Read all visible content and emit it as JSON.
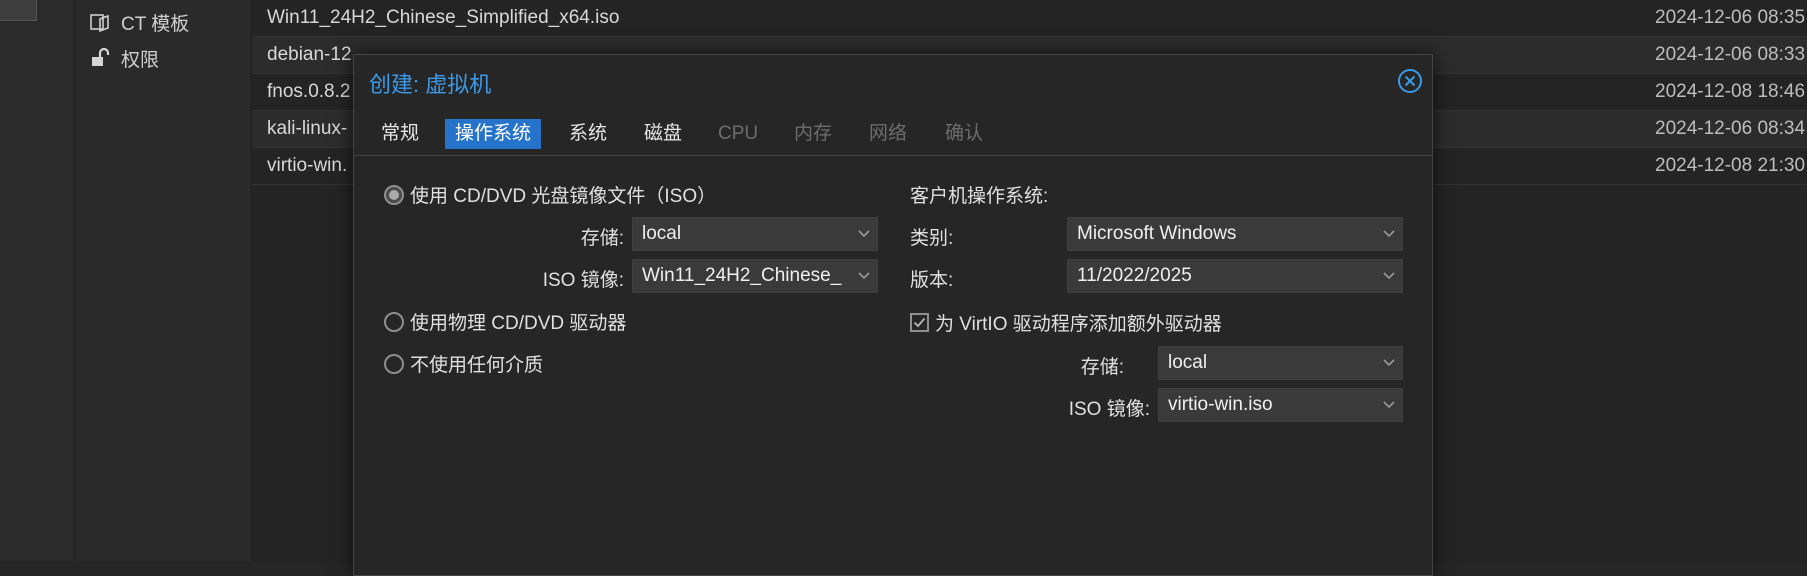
{
  "sidebar": {
    "items": [
      {
        "label": "CT 模板",
        "icon": "ct-template-icon"
      },
      {
        "label": "权限",
        "icon": "unlock-icon"
      }
    ]
  },
  "files": [
    {
      "name": "Win11_24H2_Chinese_Simplified_x64.iso",
      "date": "2024-12-06 08:35"
    },
    {
      "name": "debian-12.",
      "date": "2024-12-06 08:33"
    },
    {
      "name": "fnos.0.8.2",
      "date": "2024-12-08 18:46"
    },
    {
      "name": "kali-linux-",
      "date": "2024-12-06 08:34"
    },
    {
      "name": "virtio-win.",
      "date": "2024-12-08 21:30"
    }
  ],
  "dialog": {
    "title": "创建: 虚拟机",
    "tabs": [
      {
        "label": "常规",
        "state": "normal"
      },
      {
        "label": "操作系统",
        "state": "active"
      },
      {
        "label": "系统",
        "state": "normal"
      },
      {
        "label": "磁盘",
        "state": "normal"
      },
      {
        "label": "CPU",
        "state": "disabled"
      },
      {
        "label": "内存",
        "state": "disabled"
      },
      {
        "label": "网络",
        "state": "disabled"
      },
      {
        "label": "确认",
        "state": "disabled"
      }
    ],
    "media": {
      "option_iso": "使用 CD/DVD 光盘镜像文件（ISO）",
      "storage_label": "存储:",
      "storage_value": "local",
      "iso_label": "ISO 镜像:",
      "iso_value": "Win11_24H2_Chinese_",
      "option_physical": "使用物理 CD/DVD 驱动器",
      "option_none": "不使用任何介质",
      "selected": "iso"
    },
    "guest": {
      "heading": "客户机操作系统:",
      "type_label": "类别:",
      "type_value": "Microsoft Windows",
      "version_label": "版本:",
      "version_value": "11/2022/2025",
      "virtio_checkbox": "为 VirtIO 驱动程序添加额外驱动器",
      "virtio_checked": true,
      "storage_label": "存储:",
      "storage_value": "local",
      "iso_label": "ISO 镜像:",
      "iso_value": "virtio-win.iso"
    }
  },
  "colors": {
    "accent": "#2673cc",
    "title": "#3d9ae8",
    "background": "#262626"
  }
}
